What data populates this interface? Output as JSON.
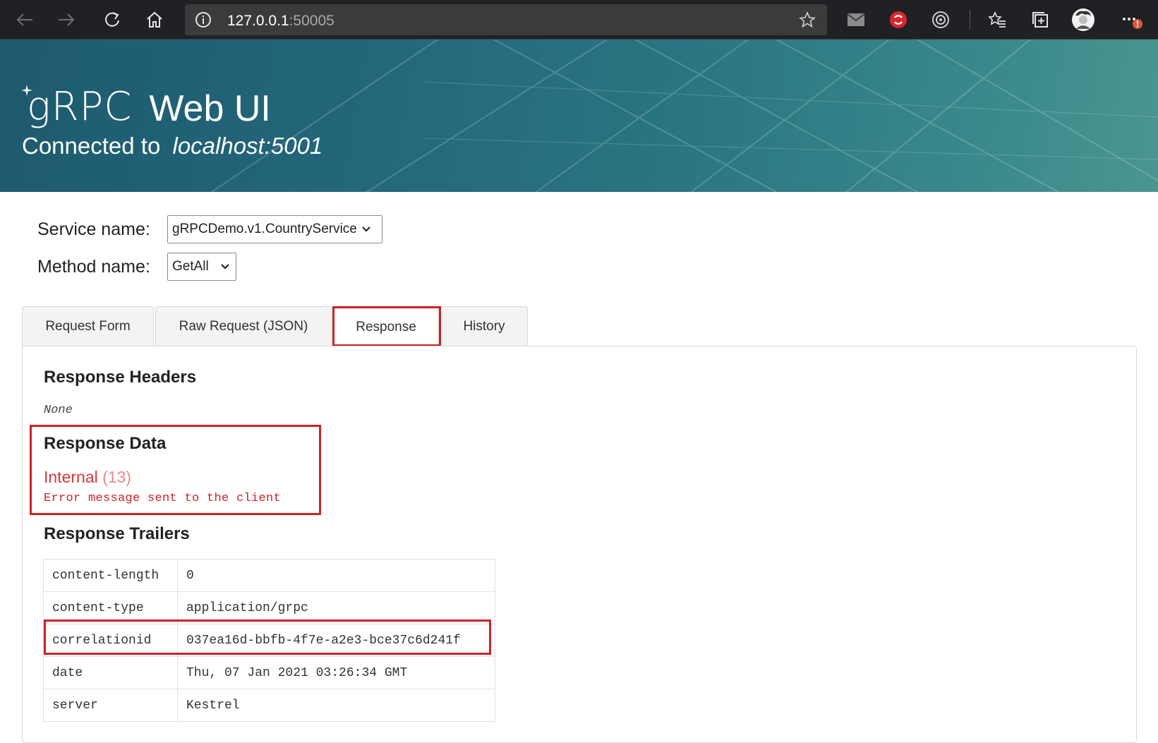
{
  "browser": {
    "url_host": "127.0.0.1",
    "url_port": ":50005"
  },
  "header": {
    "logo_text": "gRPC",
    "title": "Web UI",
    "connected_label": "Connected to",
    "connected_host": "localhost:5001"
  },
  "form": {
    "service_label": "Service name:",
    "service_value": "gRPCDemo.v1.CountryService",
    "method_label": "Method name:",
    "method_value": "GetAll"
  },
  "tabs": [
    {
      "label": "Request Form"
    },
    {
      "label": "Raw Request (JSON)"
    },
    {
      "label": "Response"
    },
    {
      "label": "History"
    }
  ],
  "response": {
    "headers_title": "Response Headers",
    "headers_value": "None",
    "data_title": "Response Data",
    "status_name": "Internal",
    "status_code": "(13)",
    "error_message": "Error message sent to the client",
    "trailers_title": "Response Trailers",
    "trailers": [
      {
        "key": "content-length",
        "value": "0"
      },
      {
        "key": "content-type",
        "value": "application/grpc"
      },
      {
        "key": "correlationid",
        "value": "037ea16d-bbfb-4f7e-a2e3-bce37c6d241f"
      },
      {
        "key": "date",
        "value": "Thu, 07 Jan 2021 03:26:34 GMT"
      },
      {
        "key": "server",
        "value": "Kestrel"
      }
    ]
  },
  "colors": {
    "highlight": "#cc2229",
    "error_text": "#d9383a",
    "banner": "#23667a"
  }
}
